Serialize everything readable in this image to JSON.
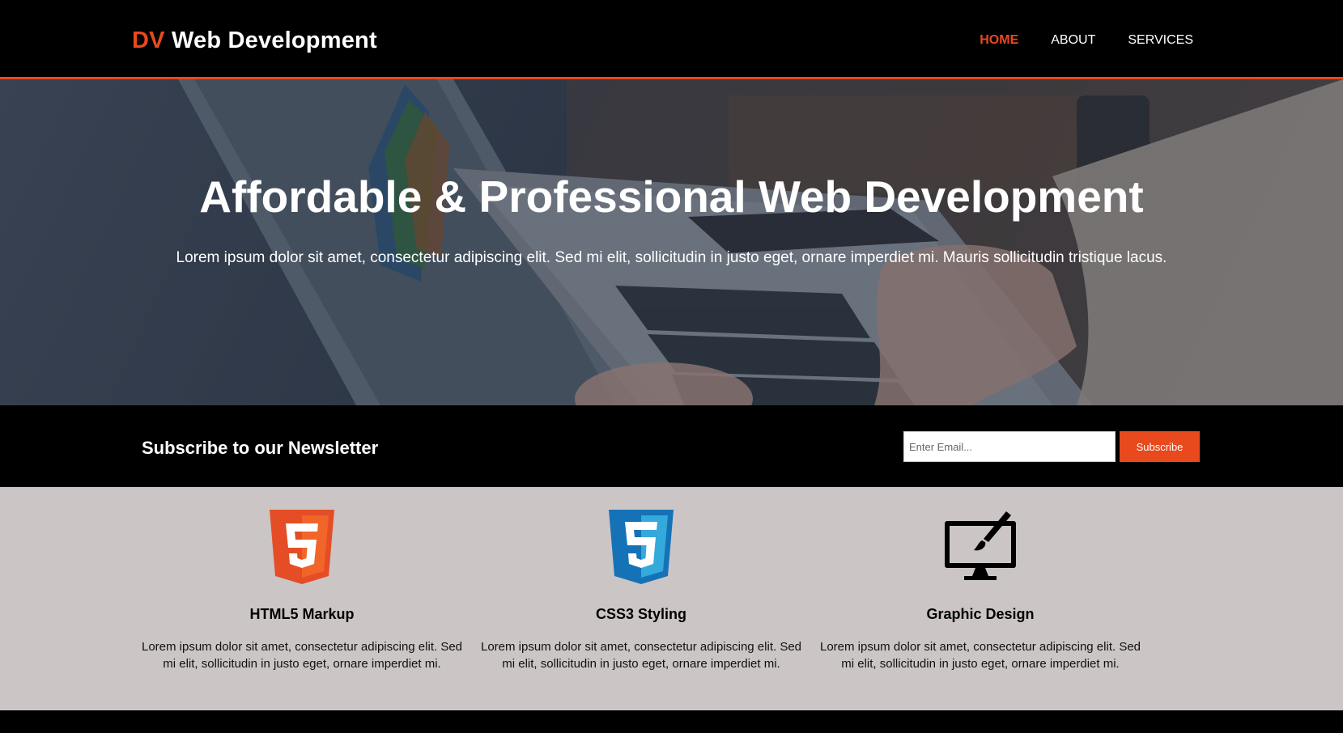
{
  "header": {
    "brand_accent": "DV",
    "brand_rest": "Web Development",
    "nav": [
      {
        "label": "HOME",
        "active": true
      },
      {
        "label": "ABOUT",
        "active": false
      },
      {
        "label": "SERVICES",
        "active": false
      }
    ]
  },
  "showcase": {
    "title": "Affordable & Professional Web Development",
    "text": "Lorem ipsum dolor sit amet, consectetur adipiscing elit. Sed mi elit, sollicitudin in justo eget, ornare imperdiet mi. Mauris sollicitudin tristique lacus."
  },
  "newsletter": {
    "title": "Subscribe to our Newsletter",
    "email_placeholder": "Enter Email...",
    "email_value": "",
    "button_label": "Subscribe"
  },
  "boxes": [
    {
      "icon": "html5-icon",
      "title": "HTML5 Markup",
      "text": "Lorem ipsum dolor sit amet, consectetur adipiscing elit. Sed mi elit, sollicitudin in justo eget, ornare imperdiet mi."
    },
    {
      "icon": "css3-icon",
      "title": "CSS3 Styling",
      "text": "Lorem ipsum dolor sit amet, consectetur adipiscing elit. Sed mi elit, sollicitudin in justo eget, ornare imperdiet mi."
    },
    {
      "icon": "graphic-design-icon",
      "title": "Graphic Design",
      "text": "Lorem ipsum dolor sit amet, consectetur adipiscing elit. Sed mi elit, sollicitudin in justo eget, ornare imperdiet mi."
    }
  ],
  "colors": {
    "accent": "#e8491d",
    "header_bg": "#000000",
    "boxes_bg": "#cbc5c5",
    "html5_orange": "#e44d26",
    "css3_blue": "#1572b6"
  }
}
